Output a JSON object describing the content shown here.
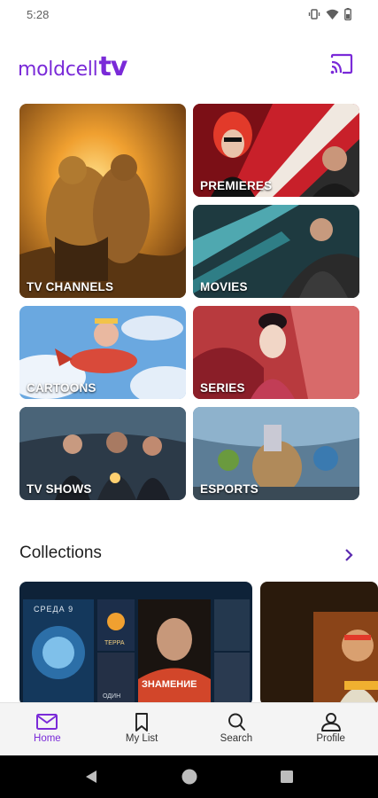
{
  "status_bar": {
    "time": "5:28"
  },
  "header": {
    "logo_word": "moldcell",
    "logo_tv": "tv",
    "accent_color": "#7a2ad8"
  },
  "categories": [
    {
      "label": "TV CHANNELS"
    },
    {
      "label": "PREMIERES"
    },
    {
      "label": "MOVIES"
    },
    {
      "label": "CARTOONS"
    },
    {
      "label": "SERIES"
    },
    {
      "label": "TV SHOWS"
    },
    {
      "label": "ESPORTS"
    }
  ],
  "collections": {
    "title": "Collections",
    "card1_text": "ЗНАМЕНИЕ",
    "card1_top_text": "СРЕДА 9",
    "card1_small1": "ТЕРРА",
    "card1_small2": "ОДИН"
  },
  "bottom_nav": [
    {
      "label": "Home",
      "icon": "home-icon",
      "active": true
    },
    {
      "label": "My List",
      "icon": "bookmark-icon",
      "active": false
    },
    {
      "label": "Search",
      "icon": "search-icon",
      "active": false
    },
    {
      "label": "Profile",
      "icon": "profile-icon",
      "active": false
    }
  ]
}
